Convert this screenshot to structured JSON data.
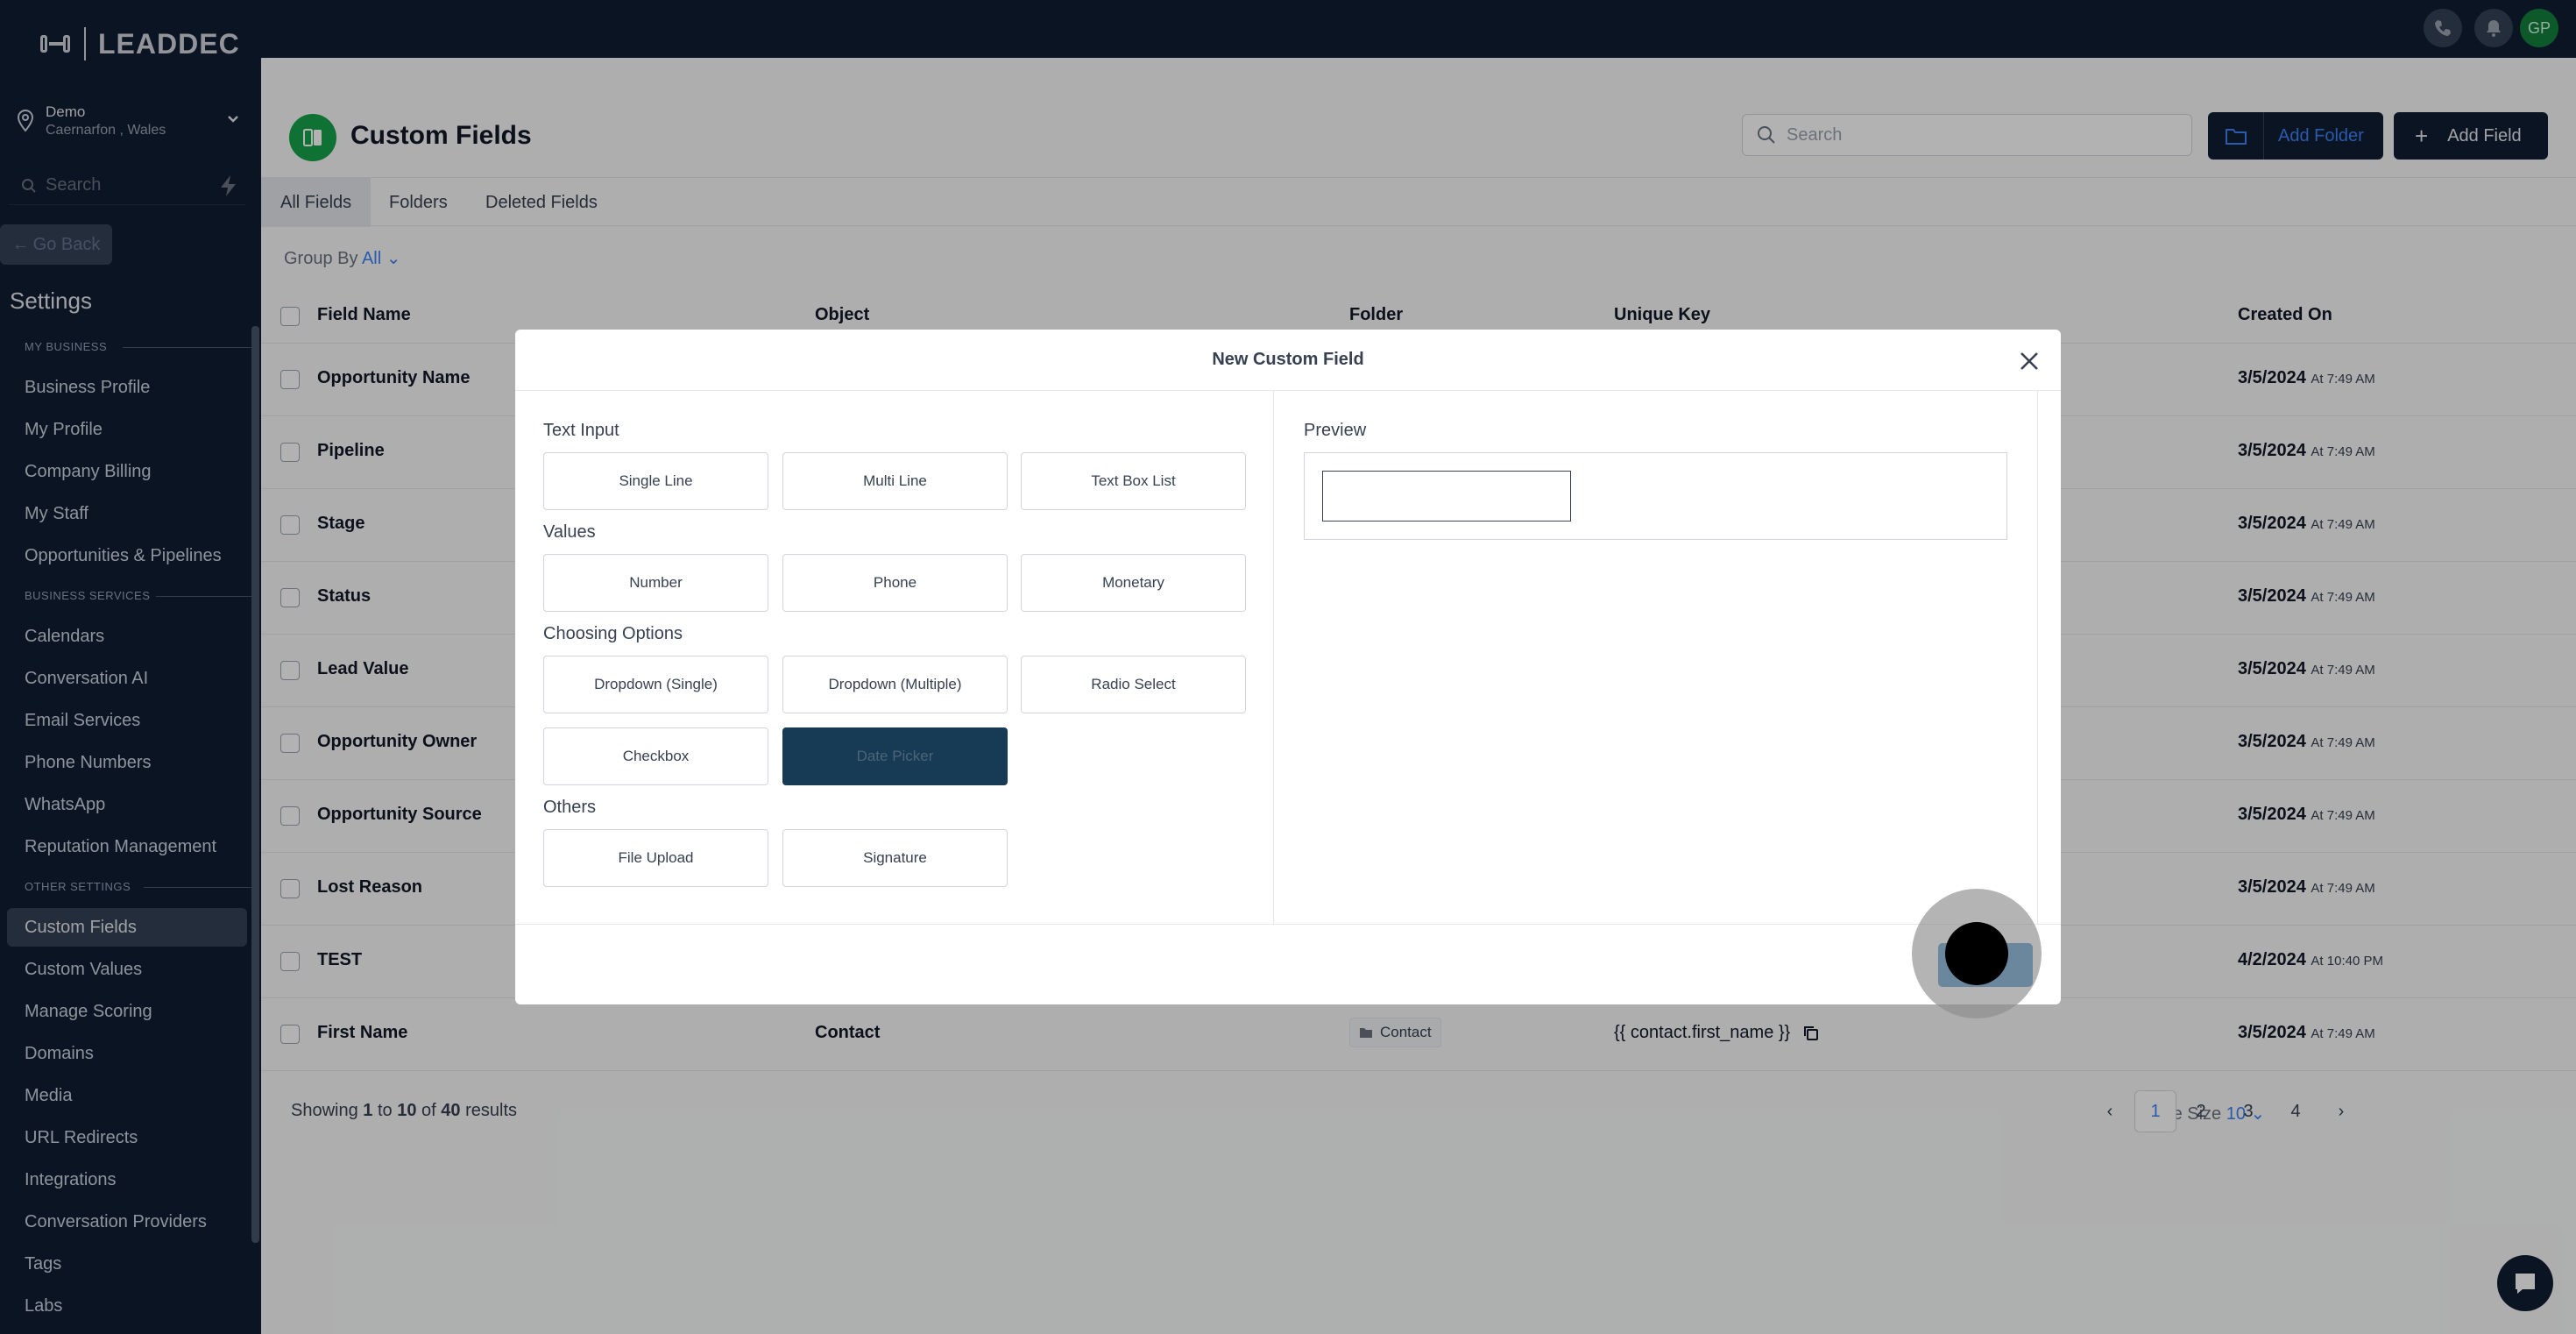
{
  "brand": {
    "name": "LEADDEC"
  },
  "location": {
    "name": "Demo",
    "address": "Caernarfon , Wales"
  },
  "sidebar": {
    "search_placeholder": "Search",
    "go_back": "Go Back",
    "settings_title": "Settings",
    "sections": [
      {
        "label": "MY BUSINESS",
        "items": [
          "Business Profile",
          "My Profile",
          "Company Billing",
          "My Staff",
          "Opportunities & Pipelines"
        ]
      },
      {
        "label": "BUSINESS SERVICES",
        "items": [
          "Calendars",
          "Conversation AI",
          "Email Services",
          "Phone Numbers",
          "WhatsApp",
          "Reputation Management"
        ]
      },
      {
        "label": "OTHER SETTINGS",
        "items": [
          "Custom Fields",
          "Custom Values",
          "Manage Scoring",
          "Domains",
          "Media",
          "URL Redirects",
          "Integrations",
          "Conversation Providers",
          "Tags",
          "Labs"
        ]
      }
    ],
    "active_item": "Custom Fields"
  },
  "topbar": {
    "avatar_initials": "GP"
  },
  "page": {
    "title": "Custom Fields",
    "search_placeholder": "Search",
    "add_folder": "Add Folder",
    "add_field": "Add Field",
    "tabs": [
      "All Fields",
      "Folders",
      "Deleted Fields"
    ],
    "group_by_label": "Group By",
    "group_by_value": "All"
  },
  "table": {
    "columns": [
      "Field Name",
      "Object",
      "Folder",
      "Unique Key",
      "Created On"
    ],
    "rows": [
      {
        "name": "Opportunity Name",
        "object": "",
        "folder": "",
        "key": "",
        "date": "3/5/2024",
        "time": "At 7:49 AM"
      },
      {
        "name": "Pipeline",
        "object": "",
        "folder": "",
        "key": "",
        "date": "3/5/2024",
        "time": "At 7:49 AM"
      },
      {
        "name": "Stage",
        "object": "",
        "folder": "",
        "key": "",
        "date": "3/5/2024",
        "time": "At 7:49 AM"
      },
      {
        "name": "Status",
        "object": "",
        "folder": "",
        "key": "",
        "date": "3/5/2024",
        "time": "At 7:49 AM"
      },
      {
        "name": "Lead Value",
        "object": "",
        "folder": "",
        "key": "",
        "date": "3/5/2024",
        "time": "At 7:49 AM"
      },
      {
        "name": "Opportunity Owner",
        "object": "",
        "folder": "",
        "key": "",
        "date": "3/5/2024",
        "time": "At 7:49 AM"
      },
      {
        "name": "Opportunity Source",
        "object": "",
        "folder": "",
        "key": "",
        "date": "3/5/2024",
        "time": "At 7:49 AM"
      },
      {
        "name": "Lost Reason",
        "object": "",
        "folder": "",
        "key": "",
        "date": "3/5/2024",
        "time": "At 7:49 AM"
      },
      {
        "name": "TEST",
        "object": "",
        "folder": "",
        "key": "",
        "date": "4/2/2024",
        "time": "At 10:40 PM"
      },
      {
        "name": "First Name",
        "object": "Contact",
        "folder": "Contact",
        "key": "{{ contact.first_name }}",
        "date": "3/5/2024",
        "time": "At 7:49 AM"
      }
    ]
  },
  "pagination": {
    "showing_prefix": "Showing",
    "from": "1",
    "to_word": "to",
    "to": "10",
    "of_word": "of",
    "total": "40",
    "results_word": "results",
    "page_size_label": "Page Size",
    "page_size": "10",
    "pages": [
      "1",
      "2",
      "3",
      "4"
    ],
    "current": "1"
  },
  "modal": {
    "title": "New Custom Field",
    "groups": [
      {
        "label": "Text Input",
        "options": [
          "Single Line",
          "Multi Line",
          "Text Box List"
        ]
      },
      {
        "label": "Values",
        "options": [
          "Number",
          "Phone",
          "Monetary"
        ]
      },
      {
        "label": "Choosing Options",
        "options": [
          "Dropdown (Single)",
          "Dropdown (Multiple)",
          "Radio Select",
          "Checkbox",
          "Date Picker"
        ]
      },
      {
        "label": "Others",
        "options": [
          "File Upload",
          "Signature"
        ]
      }
    ],
    "selected_option": "Date Picker",
    "preview_label": "Preview"
  },
  "colors": {
    "sidebar_bg": "#0f1e33",
    "accent_blue": "#3b82f6",
    "selected_option": "#173b55",
    "save_button": "#2f7fbf",
    "page_icon": "#16a34a"
  }
}
